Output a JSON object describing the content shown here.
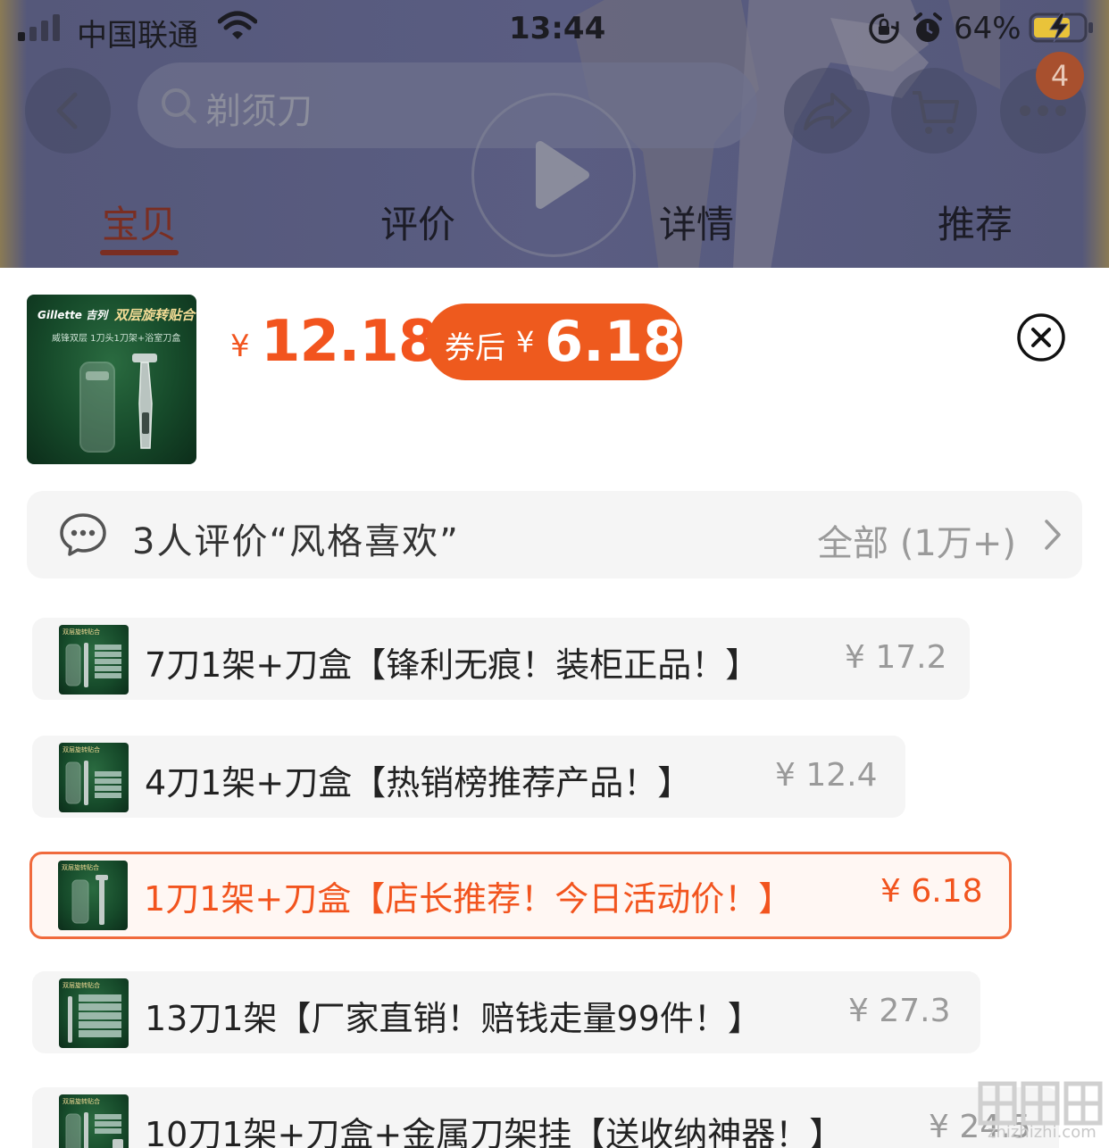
{
  "status_bar": {
    "carrier": "中国联通",
    "time": "13:44",
    "battery_percent": "64%"
  },
  "search": {
    "placeholder": "剃须刀"
  },
  "cart": {
    "badge_count": "4"
  },
  "tabs": [
    {
      "label": "宝贝",
      "active": true
    },
    {
      "label": "评价",
      "active": false
    },
    {
      "label": "详情",
      "active": false
    },
    {
      "label": "推荐",
      "active": false
    }
  ],
  "product": {
    "thumb_brand": "Gillette 吉列",
    "thumb_slogan": "双层旋转贴合",
    "thumb_sub": "威锋双层 1刀头1刀架+浴室刀盒",
    "currency": "¥",
    "price": "12.18",
    "coupon_label": "券后",
    "coupon_currency": "¥",
    "coupon_price": "6.18"
  },
  "review": {
    "summary": "3人评价“风格喜欢”",
    "all_label": "全部 (1万+)"
  },
  "skus": [
    {
      "label": "7刀1架+刀盒【锋利无痕！装柜正品！】",
      "price": "¥ 17.2",
      "selected": false
    },
    {
      "label": "4刀1架+刀盒【热销榜推荐产品！】",
      "price": "¥ 12.4",
      "selected": false
    },
    {
      "label": "1刀1架+刀盒【店长推荐！今日活动价！】",
      "price": "¥ 6.18",
      "selected": true
    },
    {
      "label": "13刀1架【厂家直销！赔钱走量99件！】",
      "price": "¥ 27.3",
      "selected": false
    },
    {
      "label": "10刀1架+刀盒+金属刀架挂【送收纳神器！】",
      "price": "¥ 24.5",
      "selected": false
    }
  ],
  "watermark": {
    "text": "zhizhizhi.com"
  },
  "colors": {
    "accent": "#f2541e",
    "coupon_bg": "#ee5a1e",
    "active_tab": "#7a2e22",
    "selected_border": "#f06a3c"
  }
}
